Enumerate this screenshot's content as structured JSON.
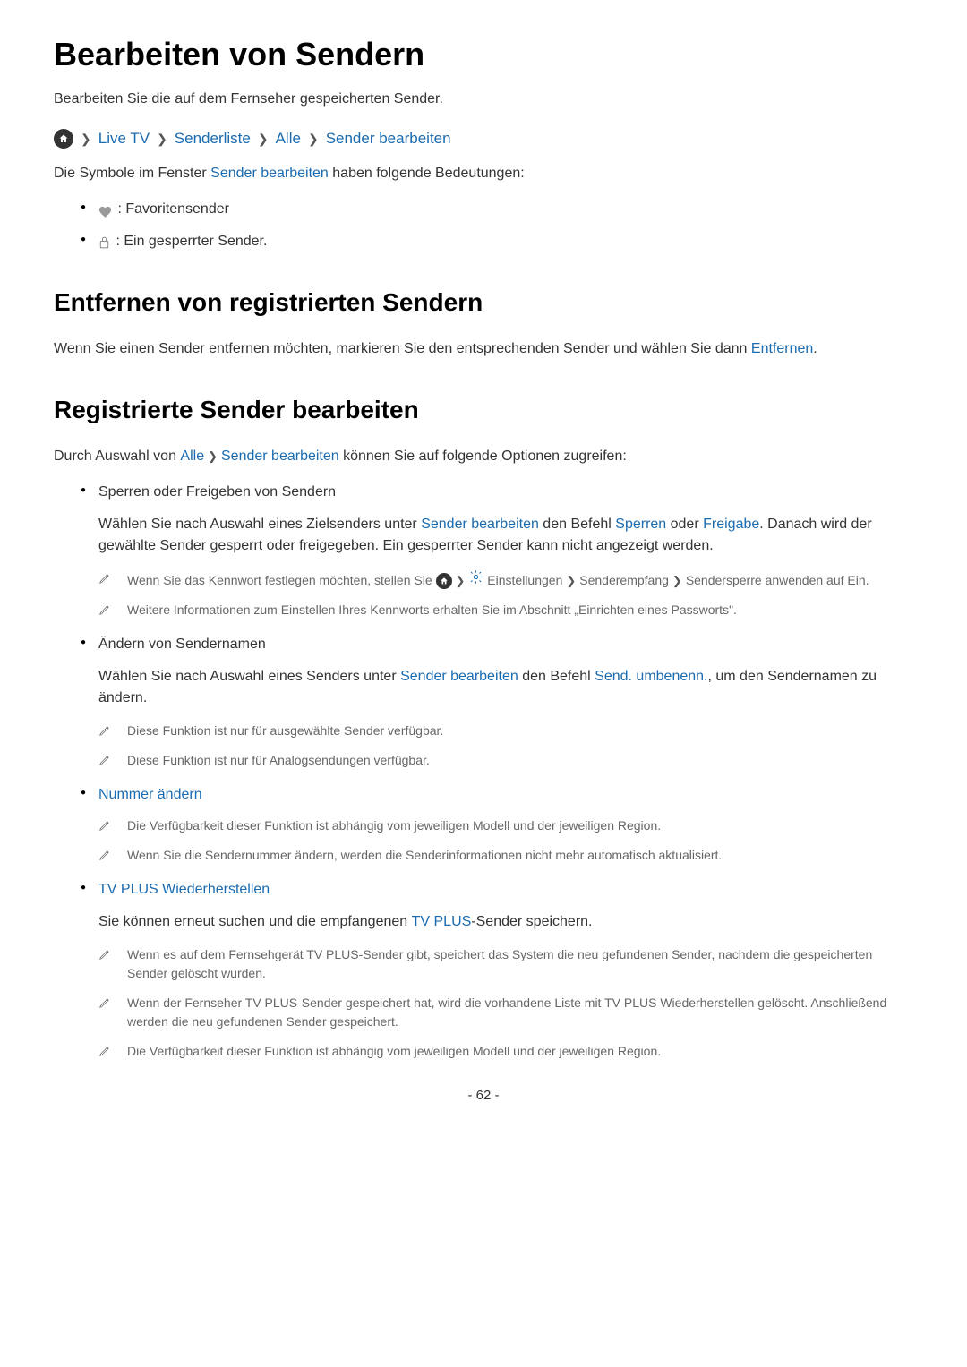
{
  "title": "Bearbeiten von Sendern",
  "subtitle": "Bearbeiten Sie die auf dem Fernseher gespeicherten Sender.",
  "breadcrumb": {
    "item1": "Live TV",
    "item2": "Senderliste",
    "item3": "Alle",
    "item4": "Sender bearbeiten"
  },
  "intro1": {
    "pre": "Die Symbole im Fenster ",
    "link": "Sender bearbeiten",
    "post": " haben folgende Bedeutungen:"
  },
  "icon_labels": {
    "heart": " : Favoritensender",
    "lock": " : Ein gesperrter Sender."
  },
  "section2": {
    "heading": "Entfernen von registrierten Sendern",
    "body_pre": "Wenn Sie einen Sender entfernen möchten, markieren Sie den entsprechenden Sender und wählen Sie dann ",
    "body_link": "Entfernen",
    "body_post": "."
  },
  "section3": {
    "heading": "Registrierte Sender bearbeiten",
    "intro_pre": "Durch Auswahl von ",
    "intro_link1": "Alle",
    "intro_link2": "Sender bearbeiten",
    "intro_post": " können Sie auf folgende Optionen zugreifen:"
  },
  "topics": {
    "t1": {
      "title": "Sperren oder Freigeben von Sendern",
      "p1_a": "Wählen Sie nach Auswahl eines Zielsenders unter ",
      "p1_b": "Sender bearbeiten",
      "p1_c": " den Befehl ",
      "p1_d": "Sperren",
      "p1_e": " oder ",
      "p1_f": "Freigabe",
      "p1_g": ". Danach wird der gewählte Sender gesperrt oder freigegeben. Ein gesperrter Sender kann nicht angezeigt werden.",
      "n1_a": "Wenn Sie das Kennwort festlegen möchten, stellen Sie ",
      "n1_b": "Einstellungen",
      "n1_c": "Senderempfang",
      "n1_d": "Sendersperre anwenden",
      "n1_e": " auf ",
      "n1_f": "Ein",
      "n1_g": ".",
      "n2_a": "Weitere Informationen zum Einstellen Ihres Kennworts erhalten Sie im Abschnitt „",
      "n2_b": "Einrichten eines Passworts",
      "n2_c": "\"."
    },
    "t2": {
      "title": "Ändern von Sendernamen",
      "p1_a": "Wählen Sie nach Auswahl eines Senders unter ",
      "p1_b": "Sender bearbeiten",
      "p1_c": " den Befehl ",
      "p1_d": "Send. umbenenn.",
      "p1_e": ", um den Sendernamen zu ändern.",
      "n1": "Diese Funktion ist nur für ausgewählte Sender verfügbar.",
      "n2": "Diese Funktion ist nur für Analogsendungen verfügbar."
    },
    "t3": {
      "title": "Nummer ändern",
      "n1": "Die Verfügbarkeit dieser Funktion ist abhängig vom jeweiligen Modell und der jeweiligen Region.",
      "n2": "Wenn Sie die Sendernummer ändern, werden die Senderinformationen nicht mehr automatisch aktualisiert."
    },
    "t4": {
      "title": "TV PLUS Wiederherstellen",
      "p1_a": "Sie können erneut suchen und die empfangenen ",
      "p1_b": "TV PLUS",
      "p1_c": "-Sender speichern.",
      "n1_a": "Wenn es auf dem Fernsehgerät ",
      "n1_b": "TV PLUS",
      "n1_c": "-Sender gibt, speichert das System die neu gefundenen Sender, nachdem die gespeicherten Sender gelöscht wurden.",
      "n2_a": "Wenn der Fernseher ",
      "n2_b": "TV PLUS",
      "n2_c": "-Sender gespeichert hat, wird die vorhandene Liste mit ",
      "n2_d": "TV PLUS Wiederherstellen",
      "n2_e": " gelöscht. Anschließend werden die neu gefundenen Sender gespeichert.",
      "n3": "Die Verfügbarkeit dieser Funktion ist abhängig vom jeweiligen Modell und der jeweiligen Region."
    }
  },
  "pagenum": "- 62 -"
}
